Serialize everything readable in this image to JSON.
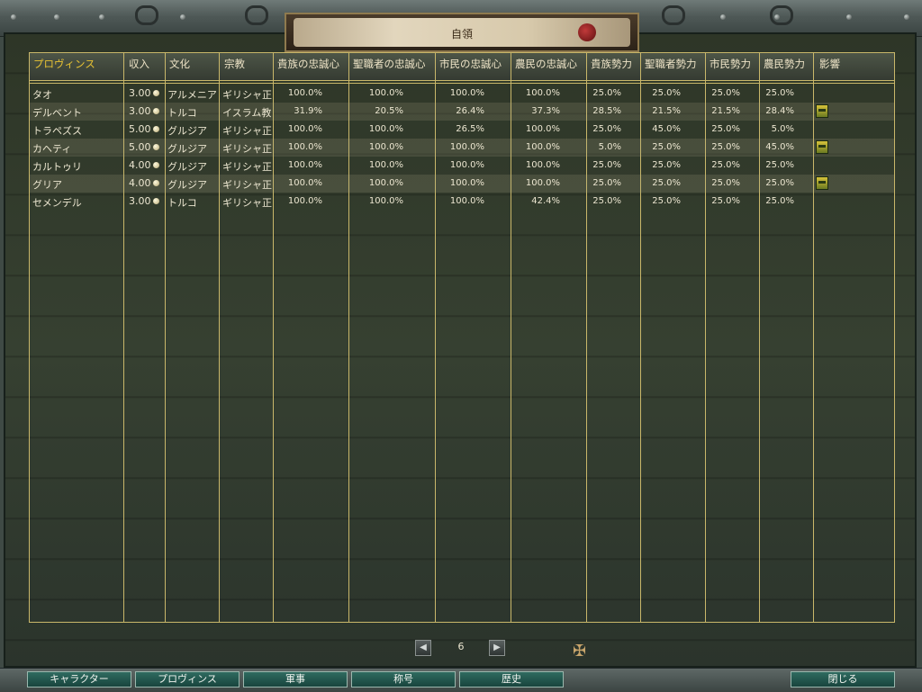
{
  "window": {
    "title": "自領"
  },
  "table": {
    "headers": [
      "プロヴィンス",
      "収入",
      "文化",
      "宗教",
      "貴族の忠誠心",
      "聖職者の忠誠心",
      "市民の忠誠心",
      "農民の忠誠心",
      "貴族勢力",
      "聖職者勢力",
      "市民勢力",
      "農民勢力",
      "影響"
    ],
    "rows": [
      {
        "province": "タオ",
        "income": "3.00",
        "culture": "アルメニア",
        "religion": "ギリシャ正",
        "noble_loyalty": "100.0%",
        "clergy_loyalty": "100.0%",
        "burgher_loyalty": "100.0%",
        "peasant_loyalty": "100.0%",
        "noble_power": "25.0%",
        "clergy_power": "25.0%",
        "burgher_power": "25.0%",
        "peasant_power": "25.0%",
        "influence_icon": "none"
      },
      {
        "province": "デルベント",
        "income": "3.00",
        "culture": "トルコ",
        "religion": "イスラム教",
        "noble_loyalty": "31.9%",
        "clergy_loyalty": "20.5%",
        "burgher_loyalty": "26.4%",
        "peasant_loyalty": "37.3%",
        "noble_power": "28.5%",
        "clergy_power": "21.5%",
        "burgher_power": "21.5%",
        "peasant_power": "28.4%",
        "influence_icon": "flag-icon"
      },
      {
        "province": "トラペズス",
        "income": "5.00",
        "culture": "グルジア",
        "religion": "ギリシャ正",
        "noble_loyalty": "100.0%",
        "clergy_loyalty": "100.0%",
        "burgher_loyalty": "26.5%",
        "peasant_loyalty": "100.0%",
        "noble_power": "25.0%",
        "clergy_power": "45.0%",
        "burgher_power": "25.0%",
        "peasant_power": "5.0%",
        "influence_icon": "none"
      },
      {
        "province": "カヘティ",
        "income": "5.00",
        "culture": "グルジア",
        "religion": "ギリシャ正",
        "noble_loyalty": "100.0%",
        "clergy_loyalty": "100.0%",
        "burgher_loyalty": "100.0%",
        "peasant_loyalty": "100.0%",
        "noble_power": "5.0%",
        "clergy_power": "25.0%",
        "burgher_power": "25.0%",
        "peasant_power": "45.0%",
        "influence_icon": "flag-icon"
      },
      {
        "province": "カルトゥリ",
        "income": "4.00",
        "culture": "グルジア",
        "religion": "ギリシャ正",
        "noble_loyalty": "100.0%",
        "clergy_loyalty": "100.0%",
        "burgher_loyalty": "100.0%",
        "peasant_loyalty": "100.0%",
        "noble_power": "25.0%",
        "clergy_power": "25.0%",
        "burgher_power": "25.0%",
        "peasant_power": "25.0%",
        "influence_icon": "none"
      },
      {
        "province": "グリア",
        "income": "4.00",
        "culture": "グルジア",
        "religion": "ギリシャ正",
        "noble_loyalty": "100.0%",
        "clergy_loyalty": "100.0%",
        "burgher_loyalty": "100.0%",
        "peasant_loyalty": "100.0%",
        "noble_power": "25.0%",
        "clergy_power": "25.0%",
        "burgher_power": "25.0%",
        "peasant_power": "25.0%",
        "influence_icon": "flag-icon"
      },
      {
        "province": "セメンデル",
        "income": "3.00",
        "culture": "トルコ",
        "religion": "ギリシャ正",
        "noble_loyalty": "100.0%",
        "clergy_loyalty": "100.0%",
        "burgher_loyalty": "100.0%",
        "peasant_loyalty": "42.4%",
        "noble_power": "25.0%",
        "clergy_power": "25.0%",
        "burgher_power": "25.0%",
        "peasant_power": "25.0%",
        "influence_icon": "none"
      }
    ]
  },
  "pagination": {
    "page": "6",
    "prev_icon": "chevron-left-icon",
    "next_icon": "chevron-right-icon"
  },
  "bottom_nav": {
    "character": "キャラクター",
    "province": "プロヴィンス",
    "military": "軍事",
    "title": "称号",
    "history": "歴史",
    "close": "閉じる"
  },
  "colors": {
    "accent_gold": "#c9b76a",
    "header_highlight": "#e7c233",
    "nav_button": "#2f6b60"
  }
}
